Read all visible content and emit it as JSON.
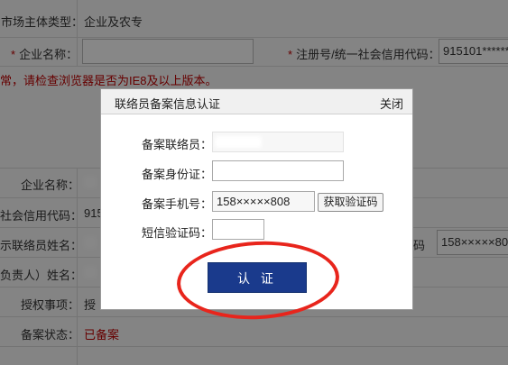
{
  "form": {
    "market_type_label": "市场主体类型：",
    "market_type_value": "企业及农专",
    "company_name_label": "企业名称：",
    "reg_no_label": "注册号/统一社会信用代码：",
    "reg_no_value": "915101*******",
    "warning_text": "常，请检查浏览器是否为IE8及以上版本。",
    "section2": {
      "company_name_label": "企业名称：",
      "credit_code_label": "社会信用代码：",
      "credit_code_value": "915",
      "contact_name_label": "示联络员姓名：",
      "phone_label_fragment": "码",
      "phone_value": "158×××××808",
      "legal_rep_label": "负责人）姓名：",
      "auth_label": "授权事项：",
      "auth_value": "授",
      "status_label": "备案状态：",
      "status_value": "已备案"
    }
  },
  "dialog": {
    "title": "联络员备案信息认证",
    "close_label": "关闭",
    "contact_label": "备案联络员：",
    "id_label": "备案身份证：",
    "id_value": "",
    "phone_label": "备案手机号：",
    "phone_value": "158×××××808",
    "get_code_label": "获取验证码",
    "sms_label": "短信验证码：",
    "sms_value": "",
    "submit_label": "认 证"
  },
  "colors": {
    "required": "#c00000",
    "submit_bg": "#1a3a8c",
    "highlight_circle": "#e8251c"
  }
}
